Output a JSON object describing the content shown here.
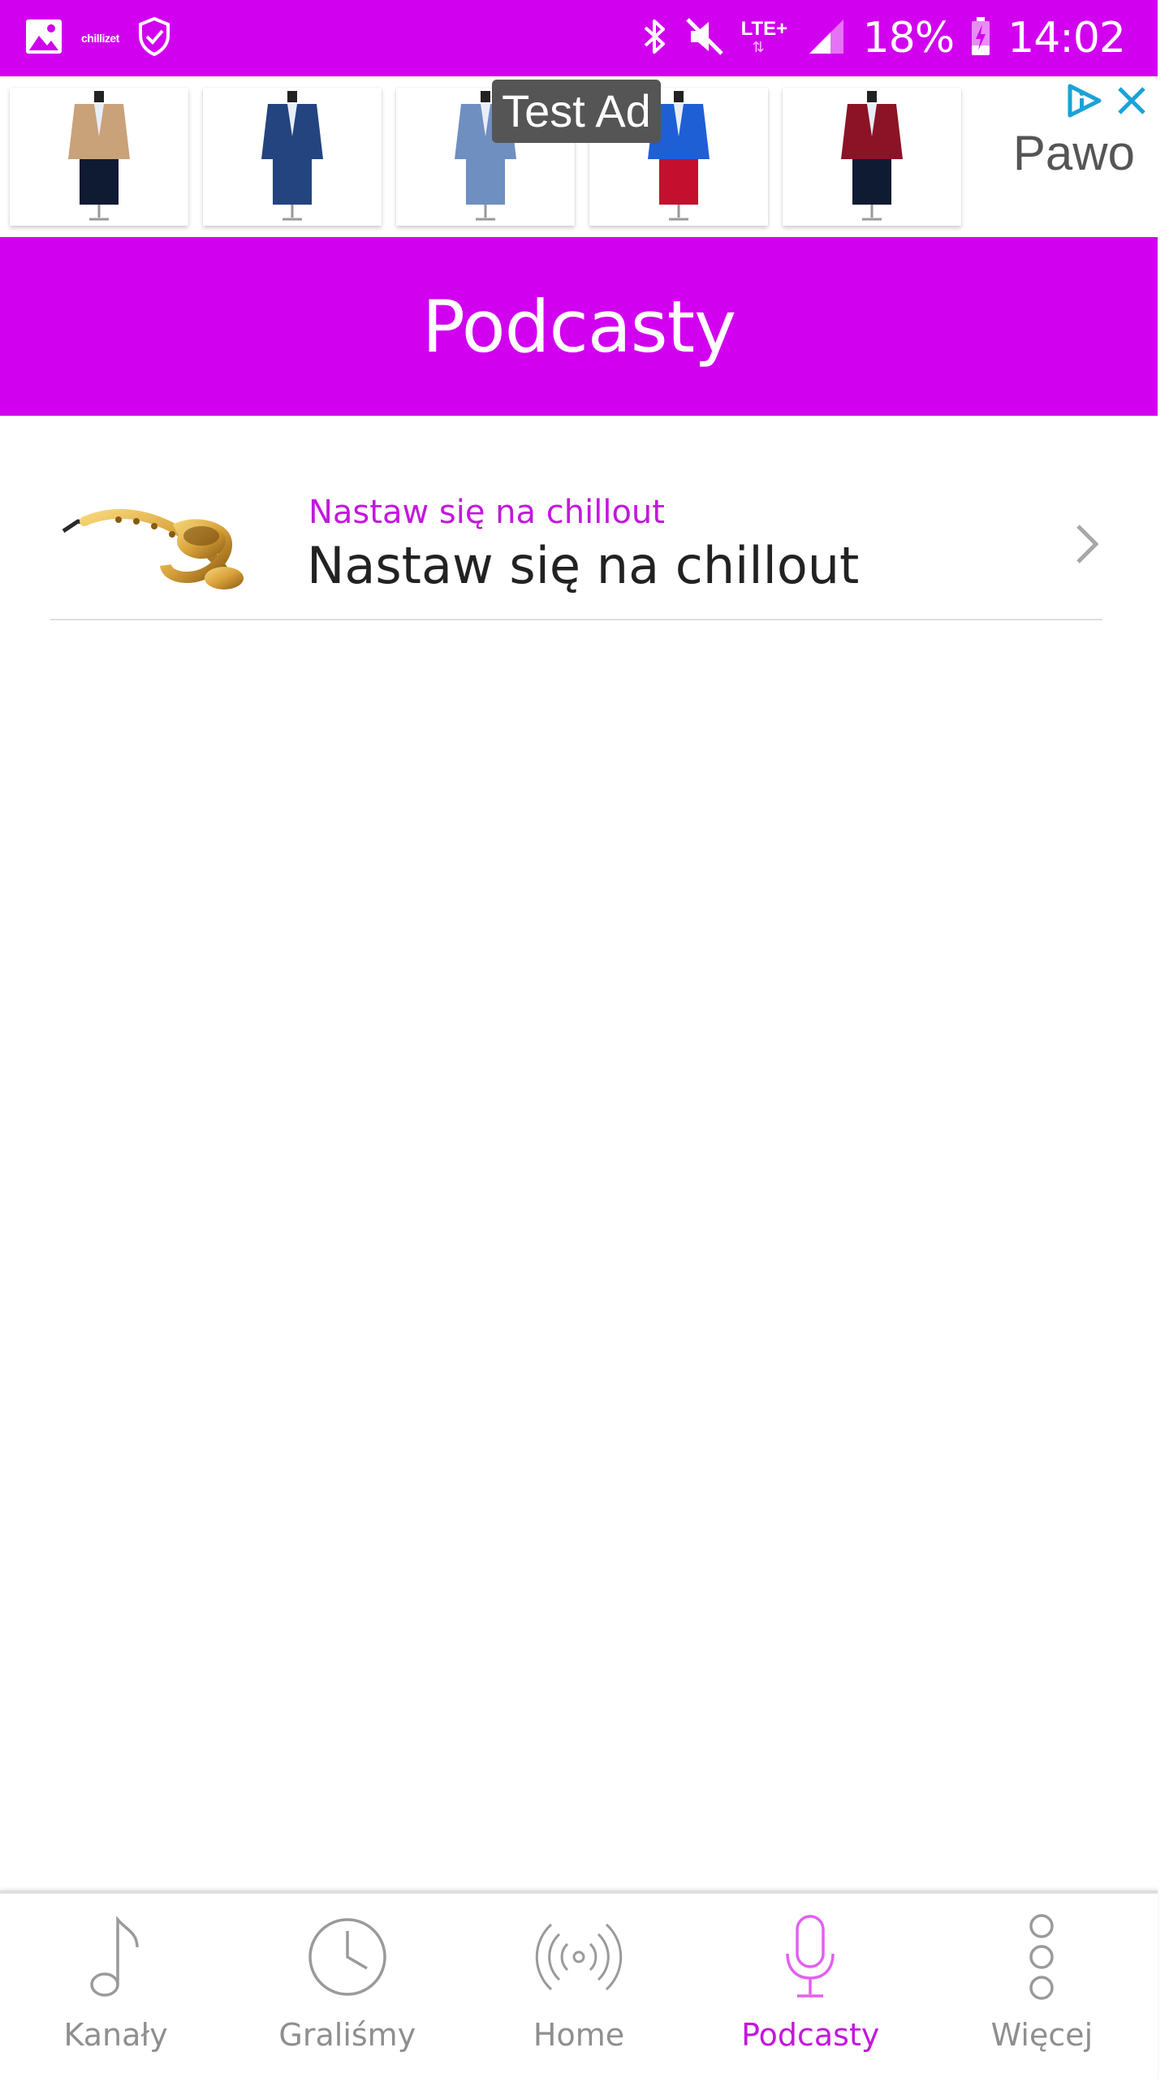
{
  "status_bar": {
    "app_label": "chillizet",
    "network": "LTE+",
    "battery": "18%",
    "time": "14:02",
    "background_color": "#d100ef"
  },
  "ad": {
    "label": "Test Ad",
    "advertiser": "Pawo",
    "products": [
      {
        "name": "suit-beige",
        "jacket_color": "#c9a27a",
        "trouser_color": "#0f1a33"
      },
      {
        "name": "suit-blue-check",
        "jacket_color": "#23447e",
        "trouser_color": "#23447e"
      },
      {
        "name": "suit-light-blue",
        "jacket_color": "#6f8fc0",
        "trouser_color": "#6f8fc0"
      },
      {
        "name": "suit-royal-blue",
        "jacket_color": "#1f5fd6",
        "trouser_color": "#c4102e"
      },
      {
        "name": "suit-burgundy",
        "jacket_color": "#8c1326",
        "trouser_color": "#0f1a33"
      }
    ]
  },
  "header": {
    "title": "Podcasty",
    "background_color": "#d100ef"
  },
  "podcasts": [
    {
      "subtitle": "Nastaw się na chillout",
      "title": "Nastaw się na chillout",
      "thumbnail": "saxophone"
    }
  ],
  "bottom_nav": {
    "items": [
      {
        "label": "Kanały",
        "icon": "music-note-icon"
      },
      {
        "label": "Graliśmy",
        "icon": "clock-icon"
      },
      {
        "label": "Home",
        "icon": "broadcast-icon"
      },
      {
        "label": "Podcasty",
        "icon": "microphone-icon"
      },
      {
        "label": "Więcej",
        "icon": "more-icon"
      }
    ],
    "active": "Podcasty",
    "active_color": "#c218dc",
    "inactive_color": "#8f8f8f"
  }
}
